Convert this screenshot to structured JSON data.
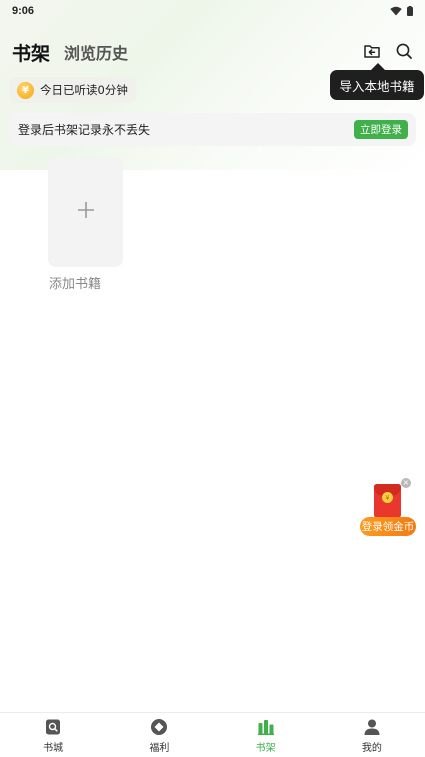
{
  "status_bar": {
    "time": "9:06",
    "icons": [
      "wifi-icon",
      "battery-icon"
    ]
  },
  "header": {
    "tabs": [
      {
        "label": "书架",
        "active": true
      },
      {
        "label": "浏览历史",
        "active": false
      }
    ],
    "icons": [
      "import-folder-icon",
      "search-icon"
    ]
  },
  "tooltip": {
    "text": "导入本地书籍"
  },
  "listen_chip": {
    "coin_symbol": "¥",
    "text": "今日已听读0分钟"
  },
  "login_banner": {
    "text": "登录后书架记录永不丢失",
    "button_label": "立即登录"
  },
  "add_book": {
    "plus": "+",
    "label": "添加书籍"
  },
  "float_redpacket": {
    "label": "登录领金币",
    "close": "×",
    "coin_symbol": "¥"
  },
  "bottom_nav": {
    "items": [
      {
        "label": "书城",
        "icon": "bookstore-icon",
        "active": false
      },
      {
        "label": "福利",
        "icon": "welfare-icon",
        "active": false
      },
      {
        "label": "书架",
        "icon": "bookshelf-icon",
        "active": true
      },
      {
        "label": "我的",
        "icon": "profile-icon",
        "active": false
      }
    ]
  },
  "colors": {
    "accent": "#3fb04a",
    "tooltip_bg": "#1f1f1f",
    "redpacket": "#e8372c",
    "orange": "#f37b12"
  }
}
